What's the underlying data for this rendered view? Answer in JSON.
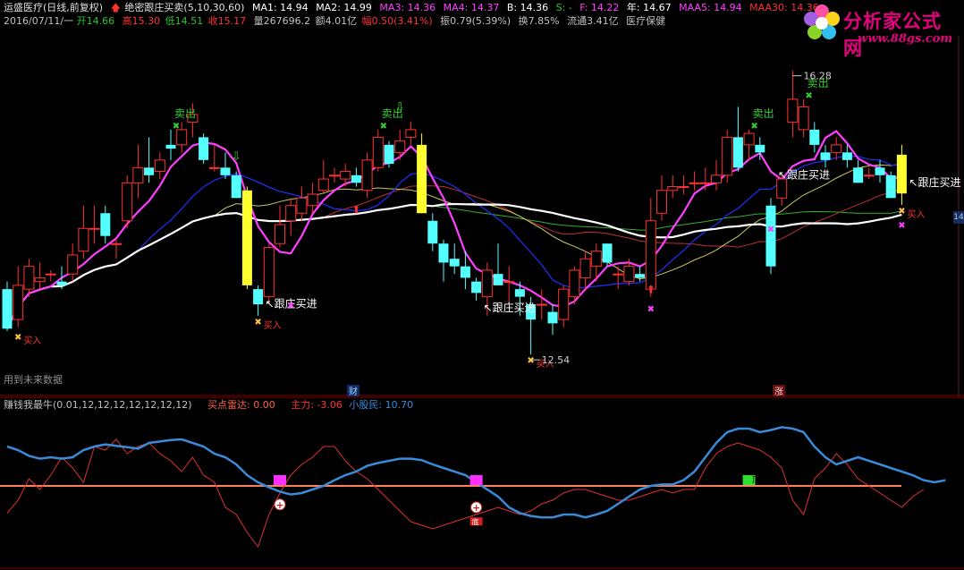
{
  "header": {
    "stock_name": "运盛医疗(日线,前复权)",
    "indicator_name": "绝密跟庄买卖(5,10,30,60)",
    "ma1": "MA1: 14.94",
    "ma2": "MA2: 14.99",
    "ma3": "MA3: 14.36",
    "ma4": "MA4: 14.37",
    "b": "B: 14.36",
    "s": "S: -",
    "f": "F: 14.22",
    "year": "年: 14.67",
    "maa5": "MAA5: 14.94",
    "maa30": "MAA30: 14.36"
  },
  "quote": {
    "date": "2016/07/11/一",
    "open": "开14.66",
    "high": "高15.30",
    "low": "低14.51",
    "close": "收15.17",
    "volume": "量267696.2",
    "amount": "额4.01亿",
    "change": "幅0.50(3.41%)",
    "amplitude": "振0.79(5.39%)",
    "turnover": "换7.85%",
    "float_cap": "流通3.41亿",
    "sector": "医疗保健"
  },
  "annotations": {
    "sell": "卖出",
    "buy": "买入",
    "follow_buy": "跟庄买进",
    "high_price": "16.28",
    "low_price": "12.54",
    "future_data": "用到未来数据",
    "cai": "财",
    "zhang": "涨",
    "right_edge": "14",
    "marker_ding": "顶",
    "marker_di": "底"
  },
  "indicator": {
    "name": "赚钱我最牛(0.01,12,12,12,12,12,12,12)",
    "radar": "买点雷达: 0.00",
    "main_force": "主力: -3.06",
    "retail": "小股民: 10.70"
  },
  "logo": {
    "brand": "分析家公式网",
    "url": "www.88gs.com"
  },
  "colors": {
    "up": "#ff3232",
    "down": "#54ffff",
    "ma_white": "#ffffff",
    "ma_magenta": "#ff40ff",
    "ma_blue": "#2030ff",
    "ma_red": "#c03030",
    "ma_green": "#30b030",
    "ma_yellow": "#c8c860",
    "highlight_bar": "#ffff30",
    "retail_line": "#3a8ad8",
    "main_force_line": "#e03030",
    "zero_line": "#ff8060"
  },
  "chart_data": {
    "type": "candlestick",
    "title": "运盛医疗(日线,前复权)",
    "candles": [
      {
        "o": 13.4,
        "h": 13.5,
        "l": 12.85,
        "c": 12.88
      },
      {
        "o": 13.0,
        "h": 13.7,
        "l": 12.9,
        "c": 13.45
      },
      {
        "o": 13.4,
        "h": 13.8,
        "l": 13.3,
        "c": 13.7
      },
      {
        "o": 13.5,
        "h": 13.75,
        "l": 13.4,
        "c": 13.55
      },
      {
        "o": 13.6,
        "h": 13.65,
        "l": 13.5,
        "c": 13.6
      },
      {
        "o": 13.5,
        "h": 13.7,
        "l": 13.4,
        "c": 13.45
      },
      {
        "o": 13.6,
        "h": 14.0,
        "l": 13.5,
        "c": 13.85
      },
      {
        "o": 13.9,
        "h": 14.5,
        "l": 13.8,
        "c": 14.2
      },
      {
        "o": 14.2,
        "h": 14.5,
        "l": 14.0,
        "c": 14.2
      },
      {
        "o": 14.4,
        "h": 14.5,
        "l": 14.0,
        "c": 14.1
      },
      {
        "o": 14.0,
        "h": 14.05,
        "l": 13.8,
        "c": 14.0
      },
      {
        "o": 14.3,
        "h": 14.9,
        "l": 14.2,
        "c": 14.8
      },
      {
        "o": 14.8,
        "h": 15.3,
        "l": 14.6,
        "c": 15.0
      },
      {
        "o": 15.0,
        "h": 15.4,
        "l": 14.8,
        "c": 14.9
      },
      {
        "o": 14.95,
        "h": 15.2,
        "l": 14.85,
        "c": 15.1
      },
      {
        "o": 15.3,
        "h": 15.5,
        "l": 15.1,
        "c": 15.25
      },
      {
        "o": 15.3,
        "h": 15.6,
        "l": 15.2,
        "c": 15.5
      },
      {
        "o": 15.6,
        "h": 15.85,
        "l": 15.4,
        "c": 15.7
      },
      {
        "o": 15.4,
        "h": 15.45,
        "l": 15.05,
        "c": 15.1
      },
      {
        "o": 15.0,
        "h": 15.3,
        "l": 14.95,
        "c": 15.0
      },
      {
        "o": 15.0,
        "h": 15.2,
        "l": 14.85,
        "c": 14.9
      },
      {
        "o": 14.9,
        "h": 14.95,
        "l": 14.6,
        "c": 14.6
      },
      {
        "o": 14.7,
        "h": 14.75,
        "l": 13.4,
        "c": 13.45
      },
      {
        "o": 13.4,
        "h": 13.45,
        "l": 13.05,
        "c": 13.2
      },
      {
        "o": 13.3,
        "h": 14.0,
        "l": 13.2,
        "c": 13.95
      },
      {
        "o": 14.0,
        "h": 14.5,
        "l": 13.95,
        "c": 14.25
      },
      {
        "o": 14.3,
        "h": 14.6,
        "l": 14.1,
        "c": 14.5
      },
      {
        "o": 14.4,
        "h": 14.75,
        "l": 14.3,
        "c": 14.6
      },
      {
        "o": 14.5,
        "h": 14.8,
        "l": 14.4,
        "c": 14.65
      },
      {
        "o": 14.7,
        "h": 15.1,
        "l": 14.65,
        "c": 14.85
      },
      {
        "o": 14.9,
        "h": 15.0,
        "l": 14.8,
        "c": 14.9
      },
      {
        "o": 14.85,
        "h": 15.05,
        "l": 14.75,
        "c": 14.95
      },
      {
        "o": 14.9,
        "h": 15.0,
        "l": 14.75,
        "c": 14.8
      },
      {
        "o": 14.7,
        "h": 15.2,
        "l": 14.6,
        "c": 15.1
      },
      {
        "o": 15.0,
        "h": 15.5,
        "l": 14.95,
        "c": 15.4
      },
      {
        "o": 15.3,
        "h": 15.35,
        "l": 15.0,
        "c": 15.05
      },
      {
        "o": 15.2,
        "h": 15.5,
        "l": 15.1,
        "c": 15.35
      },
      {
        "o": 15.4,
        "h": 15.6,
        "l": 15.3,
        "c": 15.5
      },
      {
        "o": 15.3,
        "h": 15.45,
        "l": 14.4,
        "c": 14.4
      },
      {
        "o": 14.3,
        "h": 14.4,
        "l": 13.9,
        "c": 14.0
      },
      {
        "o": 14.0,
        "h": 14.05,
        "l": 13.5,
        "c": 13.75
      },
      {
        "o": 13.8,
        "h": 14.0,
        "l": 13.6,
        "c": 13.7
      },
      {
        "o": 13.7,
        "h": 13.9,
        "l": 13.4,
        "c": 13.55
      },
      {
        "o": 13.5,
        "h": 13.55,
        "l": 13.25,
        "c": 13.35
      },
      {
        "o": 13.3,
        "h": 13.75,
        "l": 13.05,
        "c": 13.65
      },
      {
        "o": 13.6,
        "h": 14.0,
        "l": 13.5,
        "c": 13.45
      },
      {
        "o": 13.5,
        "h": 13.7,
        "l": 13.2,
        "c": 13.5
      },
      {
        "o": 13.4,
        "h": 13.5,
        "l": 13.05,
        "c": 13.3
      },
      {
        "o": 13.2,
        "h": 13.3,
        "l": 12.54,
        "c": 13.0
      },
      {
        "o": 13.2,
        "h": 13.4,
        "l": 13.0,
        "c": 13.2
      },
      {
        "o": 13.1,
        "h": 13.2,
        "l": 12.8,
        "c": 12.95
      },
      {
        "o": 13.0,
        "h": 13.45,
        "l": 12.9,
        "c": 13.4
      },
      {
        "o": 13.3,
        "h": 13.7,
        "l": 13.2,
        "c": 13.65
      },
      {
        "o": 13.55,
        "h": 13.9,
        "l": 13.4,
        "c": 13.8
      },
      {
        "o": 13.7,
        "h": 14.0,
        "l": 13.5,
        "c": 13.9
      },
      {
        "o": 14.0,
        "h": 14.0,
        "l": 13.7,
        "c": 13.75
      },
      {
        "o": 13.6,
        "h": 13.7,
        "l": 13.4,
        "c": 13.6
      },
      {
        "o": 13.5,
        "h": 13.8,
        "l": 13.45,
        "c": 13.7
      },
      {
        "o": 13.6,
        "h": 13.7,
        "l": 13.5,
        "c": 13.55
      },
      {
        "o": 13.4,
        "h": 14.6,
        "l": 13.3,
        "c": 14.3
      },
      {
        "o": 14.4,
        "h": 14.9,
        "l": 14.3,
        "c": 14.7
      },
      {
        "o": 14.7,
        "h": 14.9,
        "l": 14.6,
        "c": 14.75
      },
      {
        "o": 14.75,
        "h": 14.9,
        "l": 14.65,
        "c": 14.75
      },
      {
        "o": 14.8,
        "h": 14.95,
        "l": 14.7,
        "c": 14.8
      },
      {
        "o": 14.8,
        "h": 15.0,
        "l": 14.7,
        "c": 14.8
      },
      {
        "o": 14.8,
        "h": 15.1,
        "l": 14.7,
        "c": 14.9
      },
      {
        "o": 14.9,
        "h": 15.5,
        "l": 14.8,
        "c": 15.4
      },
      {
        "o": 15.4,
        "h": 15.8,
        "l": 14.95,
        "c": 15.0
      },
      {
        "o": 15.3,
        "h": 15.5,
        "l": 15.1,
        "c": 15.45
      },
      {
        "o": 15.3,
        "h": 15.4,
        "l": 15.1,
        "c": 15.2
      },
      {
        "o": 14.5,
        "h": 14.6,
        "l": 13.6,
        "c": 13.7
      },
      {
        "o": 14.6,
        "h": 14.9,
        "l": 14.5,
        "c": 14.85
      },
      {
        "o": 15.6,
        "h": 16.28,
        "l": 15.4,
        "c": 15.9
      },
      {
        "o": 15.5,
        "h": 15.9,
        "l": 15.4,
        "c": 15.8
      },
      {
        "o": 15.5,
        "h": 15.6,
        "l": 15.2,
        "c": 15.3
      },
      {
        "o": 15.2,
        "h": 15.3,
        "l": 15.0,
        "c": 15.1
      },
      {
        "o": 15.2,
        "h": 15.4,
        "l": 15.1,
        "c": 15.3
      },
      {
        "o": 15.2,
        "h": 15.3,
        "l": 15.0,
        "c": 15.1
      },
      {
        "o": 15.0,
        "h": 15.1,
        "l": 14.8,
        "c": 14.8
      },
      {
        "o": 14.9,
        "h": 15.0,
        "l": 14.85,
        "c": 14.9
      },
      {
        "o": 15.0,
        "h": 15.1,
        "l": 14.8,
        "c": 14.9
      },
      {
        "o": 14.9,
        "h": 14.95,
        "l": 14.6,
        "c": 14.6
      },
      {
        "o": 14.66,
        "h": 15.3,
        "l": 14.51,
        "c": 15.17
      }
    ],
    "highlight_indices": [
      22,
      38,
      82
    ],
    "price_range": [
      12.2,
      16.5
    ],
    "labels": {
      "high": "16.28",
      "low": "12.54"
    },
    "indicator": {
      "retail": [
        55,
        50,
        42,
        38,
        40,
        38,
        40,
        50,
        55,
        58,
        56,
        54,
        52,
        60,
        62,
        64,
        65,
        60,
        55,
        45,
        40,
        30,
        15,
        5,
        -2,
        -8,
        -12,
        -10,
        -5,
        0,
        8,
        15,
        20,
        28,
        32,
        35,
        38,
        38,
        36,
        30,
        25,
        20,
        15,
        5,
        -5,
        -15,
        -30,
        -38,
        -42,
        -44,
        -44,
        -40,
        -40,
        -44,
        -40,
        -35,
        -25,
        -15,
        -5,
        0,
        2,
        2,
        8,
        20,
        40,
        60,
        75,
        80,
        80,
        75,
        78,
        82,
        80,
        75,
        55,
        40,
        30,
        35,
        40,
        35,
        30,
        25,
        20,
        15,
        8,
        5,
        8
      ],
      "main_force": [
        -38,
        -20,
        10,
        -5,
        15,
        40,
        25,
        5,
        55,
        50,
        65,
        45,
        55,
        60,
        45,
        35,
        20,
        40,
        15,
        5,
        -30,
        -40,
        -65,
        -85,
        -40,
        -10,
        15,
        30,
        40,
        55,
        55,
        35,
        20,
        10,
        -5,
        -20,
        -35,
        -50,
        -55,
        -60,
        -55,
        -50,
        -45,
        -40,
        -35,
        -30,
        -35,
        -40,
        -35,
        -25,
        -20,
        -10,
        -5,
        -5,
        -10,
        -15,
        -20,
        -20,
        -15,
        -10,
        -5,
        -10,
        -5,
        -5,
        25,
        45,
        55,
        60,
        55,
        50,
        40,
        25,
        -20,
        -40,
        10,
        25,
        45,
        30,
        10,
        0,
        -10,
        -20,
        -30,
        -15,
        -5
      ],
      "zero": 0,
      "range": [
        -100,
        100
      ]
    }
  }
}
